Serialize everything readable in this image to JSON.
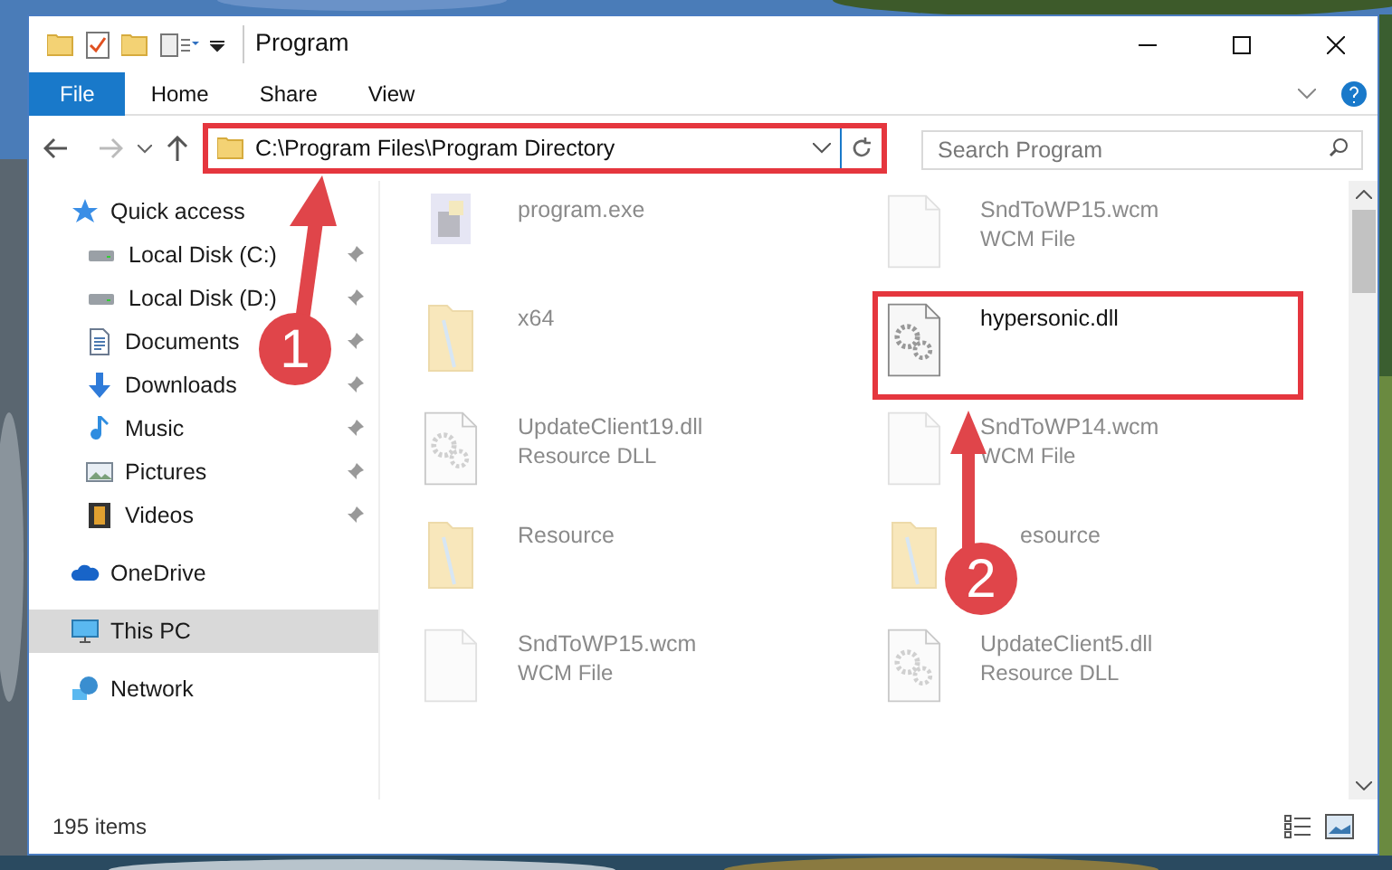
{
  "window": {
    "title": "Program"
  },
  "ribbon_tabs": [
    {
      "label": "File",
      "selected": true
    },
    {
      "label": "Home",
      "selected": false
    },
    {
      "label": "Share",
      "selected": false
    },
    {
      "label": "View",
      "selected": false
    }
  ],
  "address": {
    "path": "C:\\Program Files\\Program Directory",
    "highlighted": true
  },
  "search": {
    "placeholder": "Search Program"
  },
  "sidebar": {
    "items": [
      {
        "label": "Quick access",
        "kind": "star",
        "selected": false,
        "children": [
          {
            "label": "Local Disk (C:)",
            "kind": "drive",
            "pinned": true,
            "selected": false
          },
          {
            "label": "Local Disk (D:)",
            "kind": "drive",
            "pinned": true,
            "selected": false
          },
          {
            "label": "Documents",
            "kind": "documents",
            "pinned": true,
            "selected": false
          },
          {
            "label": "Downloads",
            "kind": "downloads",
            "pinned": true,
            "selected": false
          },
          {
            "label": "Music",
            "kind": "music",
            "pinned": true,
            "selected": false
          },
          {
            "label": "Pictures",
            "kind": "pictures",
            "pinned": true,
            "selected": false
          },
          {
            "label": "Videos",
            "kind": "videos",
            "pinned": true,
            "selected": false
          }
        ]
      },
      {
        "label": "OneDrive",
        "kind": "cloud",
        "selected": false
      },
      {
        "label": "This PC",
        "kind": "pc",
        "selected": true
      },
      {
        "label": "Network",
        "kind": "network",
        "selected": false
      }
    ]
  },
  "files": [
    {
      "name": "program.exe",
      "kind": "exe",
      "blurred": true,
      "highlighted": false,
      "partly_covered": false
    },
    {
      "name": "SndToWP15.wcm",
      "type": "WCM File",
      "kind": "blank",
      "blurred": true,
      "highlighted": false,
      "partly_covered": false
    },
    {
      "name": "x64",
      "kind": "folder",
      "blurred": true,
      "highlighted": false,
      "partly_covered": false
    },
    {
      "name": "hypersonic.dll",
      "kind": "dll",
      "blurred": false,
      "highlighted": true,
      "partly_covered": false
    },
    {
      "name": "UpdateClient19.dll",
      "type": "Resource DLL",
      "kind": "dll",
      "blurred": true,
      "highlighted": false,
      "partly_covered": false
    },
    {
      "name": "SndToWP14.wcm",
      "type": "WCM File",
      "kind": "blank",
      "blurred": true,
      "highlighted": false,
      "partly_covered": false
    },
    {
      "name": "Resource",
      "kind": "folder",
      "blurred": true,
      "highlighted": false,
      "partly_covered": false
    },
    {
      "name": "esource",
      "kind": "folder",
      "blurred": true,
      "highlighted": false,
      "partly_covered": true
    },
    {
      "name": "SndToWP15.wcm",
      "type": "WCM File",
      "kind": "blank",
      "blurred": true,
      "highlighted": false,
      "partly_covered": false
    },
    {
      "name": "UpdateClient5.dll",
      "type": "Resource DLL",
      "kind": "dll",
      "blurred": true,
      "highlighted": false,
      "partly_covered": false
    }
  ],
  "status_bar": {
    "text": "195 items"
  },
  "annotations": [
    {
      "number": "1"
    },
    {
      "number": "2"
    }
  ]
}
